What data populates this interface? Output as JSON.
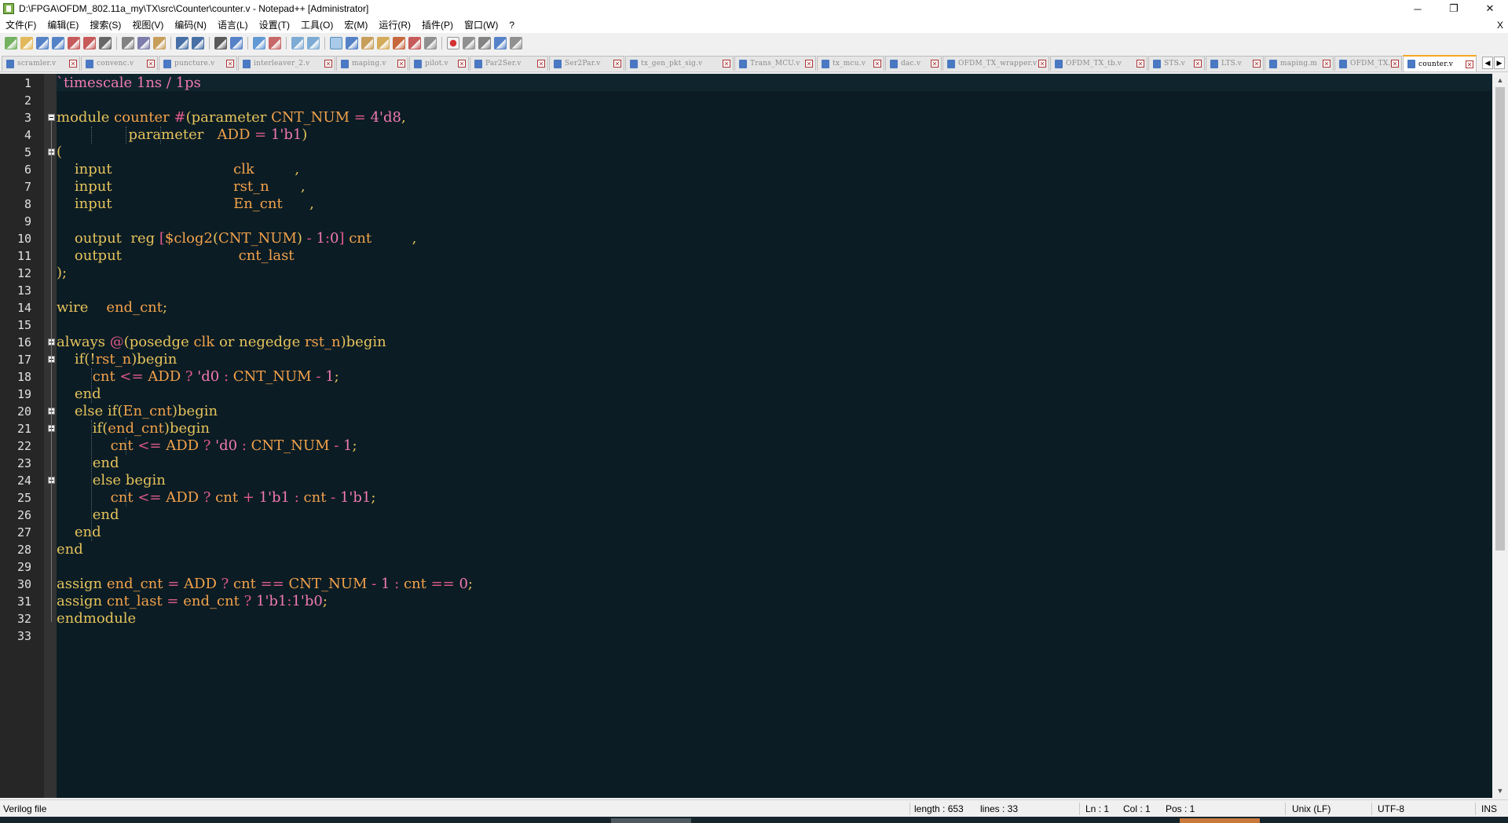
{
  "window": {
    "title": "D:\\FPGA\\OFDM_802.11a_my\\TX\\src\\Counter\\counter.v - Notepad++ [Administrator]",
    "minimize": "─",
    "restore": "❐",
    "close": "✕"
  },
  "menu": {
    "items": [
      "文件(F)",
      "编辑(E)",
      "搜索(S)",
      "视图(V)",
      "编码(N)",
      "语言(L)",
      "设置(T)",
      "工具(O)",
      "宏(M)",
      "运行(R)",
      "插件(P)",
      "窗口(W)",
      "?"
    ],
    "close": "X"
  },
  "toolbar": {
    "buttons": [
      "new-file",
      "open-file",
      "save",
      "save-all",
      "close",
      "close-all",
      "print",
      "cut",
      "copy",
      "paste",
      "undo",
      "redo",
      "find",
      "replace",
      "zoom-in",
      "zoom-out",
      "sync-vertical",
      "sync-horizontal",
      "word-wrap",
      "show-all-chars",
      "indent-guide",
      "doc-map",
      "function-list",
      "folder-workspace",
      "monitoring",
      "record-macro",
      "stop-record",
      "play-macro",
      "run-macro-multiple",
      "save-macro"
    ]
  },
  "tabs": [
    {
      "label": "scramler.v",
      "active": false
    },
    {
      "label": "convenc.v",
      "active": false
    },
    {
      "label": "puncture.v",
      "active": false
    },
    {
      "label": "interleaver_2.v",
      "active": false
    },
    {
      "label": "maping.v",
      "active": false
    },
    {
      "label": "pilot.v",
      "active": false
    },
    {
      "label": "Par2Ser.v",
      "active": false
    },
    {
      "label": "Ser2Par.v",
      "active": false
    },
    {
      "label": "tx_gen_pkt_sig.v",
      "active": false
    },
    {
      "label": "Trans_MCU.v",
      "active": false
    },
    {
      "label": "tx_mcu.v",
      "active": false
    },
    {
      "label": "dac.v",
      "active": false
    },
    {
      "label": "OFDM_TX_wrapper.v",
      "active": false
    },
    {
      "label": "OFDM_TX_tb.v",
      "active": false
    },
    {
      "label": "STS.v",
      "active": false
    },
    {
      "label": "LTS.v",
      "active": false
    },
    {
      "label": "maping.m",
      "active": false
    },
    {
      "label": "OFDM_TX.v",
      "active": false
    },
    {
      "label": "counter.v",
      "active": true
    }
  ],
  "tab_nav": {
    "left": "◀",
    "right": "▶"
  },
  "editor": {
    "lines": [
      [
        [
          "str",
          "`timescale 1ns / 1ps"
        ]
      ],
      [],
      [
        [
          "kw",
          "module "
        ],
        [
          "id",
          "counter "
        ],
        [
          "op",
          "#"
        ],
        [
          "kw",
          "("
        ],
        [
          "kw",
          "parameter "
        ],
        [
          "id",
          "CNT_NUM "
        ],
        [
          "op",
          "= "
        ],
        [
          "str",
          "4'd8"
        ],
        [
          "kw",
          ","
        ]
      ],
      [
        [
          "pl",
          "                "
        ],
        [
          "kw",
          "parameter   "
        ],
        [
          "id",
          "ADD "
        ],
        [
          "op",
          "= "
        ],
        [
          "str",
          "1'b1"
        ],
        [
          "kw",
          ")"
        ]
      ],
      [
        [
          "kw",
          "("
        ]
      ],
      [
        [
          "pl",
          "    "
        ],
        [
          "kw",
          "input                           "
        ],
        [
          "id",
          "clk         "
        ],
        [
          "kw",
          ","
        ]
      ],
      [
        [
          "pl",
          "    "
        ],
        [
          "kw",
          "input                           "
        ],
        [
          "id",
          "rst_n       "
        ],
        [
          "kw",
          ","
        ]
      ],
      [
        [
          "pl",
          "    "
        ],
        [
          "kw",
          "input                           "
        ],
        [
          "id",
          "En_cnt      "
        ],
        [
          "kw",
          ","
        ]
      ],
      [],
      [
        [
          "pl",
          "    "
        ],
        [
          "kw",
          "output  reg "
        ],
        [
          "op",
          "["
        ],
        [
          "id",
          "$clog2"
        ],
        [
          "kw",
          "("
        ],
        [
          "id",
          "CNT_NUM"
        ],
        [
          "kw",
          ") "
        ],
        [
          "op",
          "- "
        ],
        [
          "str",
          "1"
        ],
        [
          "op",
          ":"
        ],
        [
          "str",
          "0"
        ],
        [
          "op",
          "] "
        ],
        [
          "id",
          "cnt         "
        ],
        [
          "kw",
          ","
        ]
      ],
      [
        [
          "pl",
          "    "
        ],
        [
          "kw",
          "output                          "
        ],
        [
          "id",
          "cnt_last"
        ]
      ],
      [
        [
          "kw",
          ");"
        ]
      ],
      [],
      [
        [
          "kw",
          "wire    "
        ],
        [
          "id",
          "end_cnt"
        ],
        [
          "kw",
          ";"
        ]
      ],
      [],
      [
        [
          "kw",
          "always "
        ],
        [
          "op",
          "@"
        ],
        [
          "kw",
          "(posedge "
        ],
        [
          "id",
          "clk "
        ],
        [
          "kw",
          "or negedge "
        ],
        [
          "id",
          "rst_n"
        ],
        [
          "kw",
          ")begin"
        ]
      ],
      [
        [
          "pl",
          "    "
        ],
        [
          "kw",
          "if(!"
        ],
        [
          "id",
          "rst_n"
        ],
        [
          "kw",
          ")begin"
        ]
      ],
      [
        [
          "pl",
          "        "
        ],
        [
          "id",
          "cnt "
        ],
        [
          "op",
          "<= "
        ],
        [
          "id",
          "ADD "
        ],
        [
          "op",
          "? "
        ],
        [
          "str",
          "'d0 "
        ],
        [
          "op",
          ": "
        ],
        [
          "id",
          "CNT_NUM "
        ],
        [
          "op",
          "- "
        ],
        [
          "str",
          "1"
        ],
        [
          "kw",
          ";"
        ]
      ],
      [
        [
          "pl",
          "    "
        ],
        [
          "kw",
          "end"
        ]
      ],
      [
        [
          "pl",
          "    "
        ],
        [
          "kw",
          "else if("
        ],
        [
          "id",
          "En_cnt"
        ],
        [
          "kw",
          ")begin"
        ]
      ],
      [
        [
          "pl",
          "        "
        ],
        [
          "kw",
          "if("
        ],
        [
          "id",
          "end_cnt"
        ],
        [
          "kw",
          ")begin"
        ]
      ],
      [
        [
          "pl",
          "            "
        ],
        [
          "id",
          "cnt "
        ],
        [
          "op",
          "<= "
        ],
        [
          "id",
          "ADD "
        ],
        [
          "op",
          "? "
        ],
        [
          "str",
          "'d0 "
        ],
        [
          "op",
          ": "
        ],
        [
          "id",
          "CNT_NUM "
        ],
        [
          "op",
          "- "
        ],
        [
          "str",
          "1"
        ],
        [
          "kw",
          ";"
        ]
      ],
      [
        [
          "pl",
          "        "
        ],
        [
          "kw",
          "end"
        ]
      ],
      [
        [
          "pl",
          "        "
        ],
        [
          "kw",
          "else begin"
        ]
      ],
      [
        [
          "pl",
          "            "
        ],
        [
          "id",
          "cnt "
        ],
        [
          "op",
          "<= "
        ],
        [
          "id",
          "ADD "
        ],
        [
          "op",
          "? "
        ],
        [
          "id",
          "cnt "
        ],
        [
          "op",
          "+ "
        ],
        [
          "str",
          "1'b1 "
        ],
        [
          "op",
          ": "
        ],
        [
          "id",
          "cnt "
        ],
        [
          "op",
          "- "
        ],
        [
          "str",
          "1'b1"
        ],
        [
          "kw",
          ";"
        ]
      ],
      [
        [
          "pl",
          "        "
        ],
        [
          "kw",
          "end"
        ]
      ],
      [
        [
          "pl",
          "    "
        ],
        [
          "kw",
          "end"
        ]
      ],
      [
        [
          "kw",
          "end"
        ]
      ],
      [],
      [
        [
          "kw",
          "assign "
        ],
        [
          "id",
          "end_cnt "
        ],
        [
          "op",
          "= "
        ],
        [
          "id",
          "ADD "
        ],
        [
          "op",
          "? "
        ],
        [
          "id",
          "cnt "
        ],
        [
          "op",
          "== "
        ],
        [
          "id",
          "CNT_NUM "
        ],
        [
          "op",
          "- "
        ],
        [
          "str",
          "1 "
        ],
        [
          "op",
          ": "
        ],
        [
          "id",
          "cnt "
        ],
        [
          "op",
          "== "
        ],
        [
          "str",
          "0"
        ],
        [
          "kw",
          ";"
        ]
      ],
      [
        [
          "kw",
          "assign "
        ],
        [
          "id",
          "cnt_last "
        ],
        [
          "op",
          "= "
        ],
        [
          "id",
          "end_cnt "
        ],
        [
          "op",
          "? "
        ],
        [
          "str",
          "1'b1"
        ],
        [
          "op",
          ":"
        ],
        [
          "str",
          "1'b0"
        ],
        [
          "kw",
          ";"
        ]
      ],
      [
        [
          "kw",
          "endmodule"
        ]
      ],
      []
    ],
    "fold_lines": [
      3,
      5,
      16,
      17,
      20,
      21,
      24
    ]
  },
  "colors": {
    "editor_bg": "#0b1c24",
    "keyword": "#e6c35c",
    "string_number": "#f07ab0",
    "operator": "#e05a8a",
    "identifier": "#f3a24b",
    "active_tab_accent": "#f5a623"
  },
  "status": {
    "file_type": "Verilog file",
    "length": "length : 653",
    "lines": "lines : 33",
    "ln": "Ln : 1",
    "col": "Col : 1",
    "pos": "Pos : 1",
    "eol": "Unix (LF)",
    "encoding": "UTF-8",
    "mode": "INS"
  }
}
